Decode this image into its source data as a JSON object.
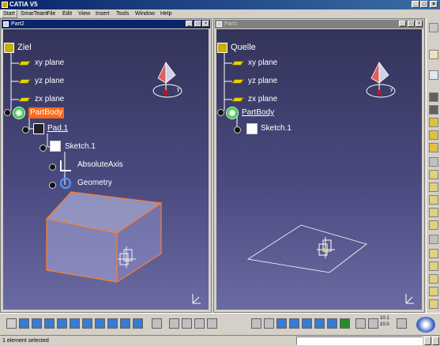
{
  "app": {
    "title": "CATIA V5"
  },
  "menu": [
    "Start",
    "SmarTeam",
    "File",
    "Edit",
    "View",
    "Insert",
    "Tools",
    "Window",
    "Help"
  ],
  "windows": [
    {
      "title": "Part2",
      "tree": {
        "root": "Ziel",
        "planes": [
          "xy plane",
          "yz plane",
          "zx plane"
        ],
        "body": "PartBody",
        "children": [
          "Pad.1",
          "Sketch.1",
          "AbsoluteAxis",
          "Geometry"
        ]
      }
    },
    {
      "title": "Part1",
      "tree": {
        "root": "Quelle",
        "planes": [
          "xy plane",
          "yz plane",
          "zx plane"
        ],
        "body": "PartBody",
        "children": [
          "Sketch.1"
        ]
      }
    }
  ],
  "compass_axis_label": "y",
  "bottom_toolbar": {
    "num_a": "10.1",
    "num_b": "10.0"
  },
  "status": {
    "message": "1 element selected"
  },
  "colors": {
    "viewport_top": "#33335a",
    "viewport_bottom": "#6b6ba3",
    "highlight": "#ff6a1a",
    "selection_edge": "#ff7f27"
  }
}
